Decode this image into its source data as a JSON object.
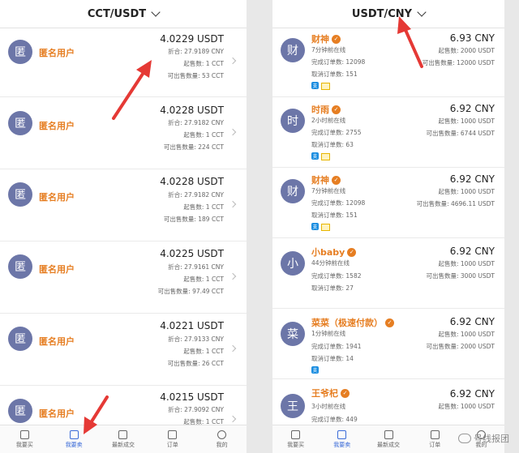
{
  "left": {
    "header": "CCT/USDT",
    "cards": [
      {
        "avatar": "匿",
        "name": "匿名用户",
        "price": "4.0229 USDT",
        "equiv": "折合: 27.9189 CNY",
        "min": "起售数: 1 CCT",
        "avail": "可出售数量: 53 CCT"
      },
      {
        "avatar": "匿",
        "name": "匿名用户",
        "price": "4.0228 USDT",
        "equiv": "折合: 27.9182 CNY",
        "min": "起售数: 1 CCT",
        "avail": "可出售数量: 224 CCT"
      },
      {
        "avatar": "匿",
        "name": "匿名用户",
        "price": "4.0228 USDT",
        "equiv": "折合: 27.9182 CNY",
        "min": "起售数: 1 CCT",
        "avail": "可出售数量: 189 CCT"
      },
      {
        "avatar": "匿",
        "name": "匿名用户",
        "price": "4.0225 USDT",
        "equiv": "折合: 27.9161 CNY",
        "min": "起售数: 1 CCT",
        "avail": "可出售数量: 97.49 CCT"
      },
      {
        "avatar": "匿",
        "name": "匿名用户",
        "price": "4.0221 USDT",
        "equiv": "折合: 27.9133 CNY",
        "min": "起售数: 1 CCT",
        "avail": "可出售数量: 26 CCT"
      },
      {
        "avatar": "匿",
        "name": "匿名用户",
        "price": "4.0215 USDT",
        "equiv": "折合: 27.9092 CNY",
        "min": "起售数: 1 CCT",
        "avail": ""
      }
    ],
    "tabs": [
      "我要买",
      "我要卖",
      "最新成交",
      "订单",
      "我的"
    ]
  },
  "right": {
    "header": "USDT/CNY",
    "cards": [
      {
        "avatar": "财",
        "name": "财神",
        "online": "7分钟前在线",
        "orders": "完成订单数: 12098",
        "cancels": "取消订单数: 151",
        "price": "6.93 CNY",
        "min": "起售数: 2000 USDT",
        "avail": "可出售数量: 12000 USDT"
      },
      {
        "avatar": "时",
        "name": "时雨",
        "online": "2小时前在线",
        "orders": "完成订单数: 2755",
        "cancels": "取消订单数: 63",
        "price": "6.92 CNY",
        "min": "起售数: 1000 USDT",
        "avail": "可出售数量: 6744 USDT"
      },
      {
        "avatar": "财",
        "name": "财神",
        "online": "7分钟前在线",
        "orders": "完成订单数: 12098",
        "cancels": "取消订单数: 151",
        "price": "6.92 CNY",
        "min": "起售数: 1000 USDT",
        "avail": "可出售数量: 4696.11 USDT"
      },
      {
        "avatar": "小",
        "name": "小baby",
        "online": "44分钟前在线",
        "orders": "完成订单数: 1582",
        "cancels": "取消订单数: 27",
        "price": "6.92 CNY",
        "min": "起售数: 1000 USDT",
        "avail": "可出售数量: 3000 USDT"
      },
      {
        "avatar": "菜",
        "name": "菜菜（极速付款）",
        "online": "1分钟前在线",
        "orders": "完成订单数: 1941",
        "cancels": "取消订单数: 14",
        "price": "6.92 CNY",
        "min": "起售数: 1000 USDT",
        "avail": "可出售数量: 2000 USDT"
      },
      {
        "avatar": "王",
        "name": "王爷杞",
        "online": "3小时前在线",
        "orders": "完成订单数: 449",
        "cancels": "",
        "price": "6.92 CNY",
        "min": "起售数: 1000 USDT",
        "avail": ""
      }
    ],
    "tabs": [
      "我要买",
      "我要卖",
      "最新成交",
      "订单",
      "我的"
    ]
  },
  "watermark": "号线报团",
  "colors": {
    "accent": "#e67e22",
    "tab_active": "#3a6bd8",
    "avatar": "#6c76a8",
    "arrow": "#e53935"
  }
}
